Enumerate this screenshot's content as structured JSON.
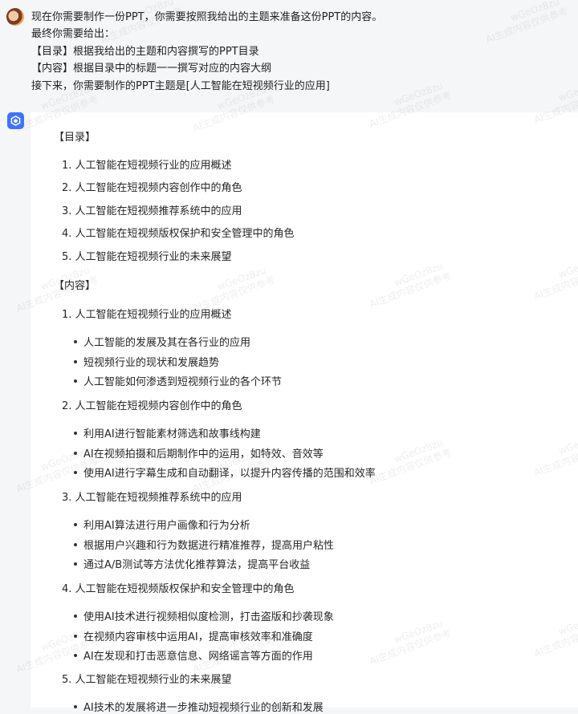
{
  "user_message": [
    "现在你需要制作一份PPT，你需要按照我给出的主题来准备这份PPT的内容。",
    "最终你需要给出：",
    "【目录】根据我给出的主题和内容撰写的PPT目录",
    "【内容】根据目录中的标题一一撰写对应的内容大纲",
    "接下来，你需要制作的PPT主题是[人工智能在短视频行业的应用]"
  ],
  "answer": {
    "toc_title": "【目录】",
    "toc": [
      "1. 人工智能在短视频行业的应用概述",
      "2. 人工智能在短视频内容创作中的角色",
      "3. 人工智能在短视频推荐系统中的应用",
      "4. 人工智能在短视频版权保护和安全管理中的角色",
      "5. 人工智能在短视频行业的未来展望"
    ],
    "content_title": "【内容】",
    "sections": [
      {
        "title": "1. 人工智能在短视频行业的应用概述",
        "bullets": [
          "人工智能的发展及其在各行业的应用",
          "短视频行业的现状和发展趋势",
          "人工智能如何渗透到短视频行业的各个环节"
        ]
      },
      {
        "title": "2. 人工智能在短视频内容创作中的角色",
        "bullets": [
          "利用AI进行智能素材筛选和故事线构建",
          "AI在视频拍摄和后期制作中的运用，如特效、音效等",
          "使用AI进行字幕生成和自动翻译，以提升内容传播的范围和效率"
        ]
      },
      {
        "title": "3. 人工智能在短视频推荐系统中的应用",
        "bullets": [
          "利用AI算法进行用户画像和行为分析",
          "根据用户兴趣和行为数据进行精准推荐，提高用户粘性",
          "通过A/B测试等方法优化推荐算法，提高平台收益"
        ]
      },
      {
        "title": "4. 人工智能在短视频版权保护和安全管理中的角色",
        "bullets": [
          "使用AI技术进行视频相似度检测，打击盗版和抄袭现象",
          "在视频内容审核中运用AI，提高审核效率和准确度",
          "AI在发现和打击恶意信息、网络谣言等方面的作用"
        ]
      },
      {
        "title": "5. 人工智能在短视频行业的未来展望",
        "bullets": [
          "AI技术的发展将进一步推动短视频行业的创新和发展"
        ]
      }
    ]
  },
  "watermark": {
    "line1": "wGeOz8zu",
    "line2": "AI生成内容仅供参考"
  },
  "colors": {
    "accent": "#3f73ff",
    "panel": "#ffffff",
    "page": "#f5f6f8"
  }
}
